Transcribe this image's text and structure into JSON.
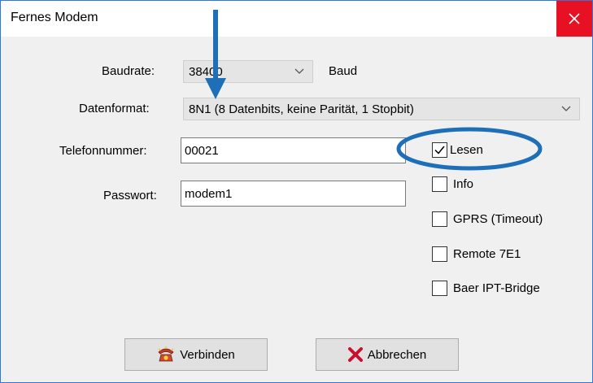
{
  "window": {
    "title": "Fernes Modem",
    "close_icon": "close-icon"
  },
  "form": {
    "baudrate_label": "Baudrate:",
    "baudrate_value": "38400",
    "baud_unit": "Baud",
    "datenformat_label": "Datenformat:",
    "datenformat_value": "8N1 (8 Datenbits, keine Parität, 1 Stopbit)",
    "telefon_label": "Telefonnummer:",
    "telefon_value": "00021",
    "passwort_label": "Passwort:",
    "passwort_value": "modem1"
  },
  "options": [
    {
      "label": "Lesen",
      "checked": true
    },
    {
      "label": "Info",
      "checked": false
    },
    {
      "label": "GPRS (Timeout)",
      "checked": false
    },
    {
      "label": "Remote 7E1",
      "checked": false
    },
    {
      "label": "Baer IPT-Bridge",
      "checked": false
    }
  ],
  "buttons": {
    "verbinden_label": "Verbinden",
    "verbinden_icon": "phone-icon",
    "abbrechen_label": "Abbrechen",
    "abbrechen_icon": "red-x-icon"
  },
  "colors": {
    "accent": "#1f6fb8",
    "close_bg": "#e81123",
    "window_bg": "#f0f0f0"
  }
}
